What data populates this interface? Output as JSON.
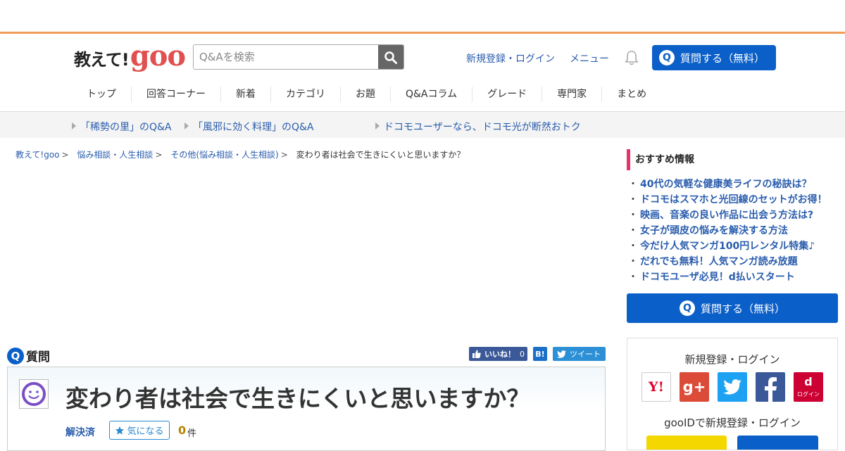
{
  "header": {
    "logo_ja": "教えて!",
    "logo_goo": "goo",
    "search_placeholder": "Q&Aを検索",
    "login_link": "新規登録・ログイン",
    "menu_link": "メニュー",
    "ask_button": "質問する（無料）"
  },
  "nav": {
    "items": [
      "トップ",
      "回答コーナー",
      "新着",
      "カテゴリ",
      "お題",
      "Q&Aコラム",
      "グレード",
      "専門家",
      "まとめ"
    ]
  },
  "subbar": {
    "links": [
      "「稀勢の里」のQ&A",
      "「風邪に効く料理」のQ&A",
      "ドコモユーザーなら、ドコモ光が断然おトク"
    ]
  },
  "breadcrumb": {
    "items": [
      "教えて!goo",
      "悩み相談・人生相談",
      "その他(悩み相談・人生相談)"
    ],
    "current": "変わり者は社会で生きにくいと思いますか？",
    "separator": ">"
  },
  "question": {
    "section_label": "質問",
    "title": "変わり者は社会で生きにくいと思いますか？",
    "status": "解決済",
    "bookmark_label": "気になる",
    "count": "0",
    "count_unit": "件"
  },
  "social": {
    "like_label": "いいね！",
    "like_count": "0",
    "hatena_label": "B!",
    "tweet_label": "ツイート"
  },
  "sidebar": {
    "recommend_title": "おすすめ情報",
    "recommend_items": [
      "40代の気軽な健康美ライフの秘訣は？",
      "ドコモはスマホと光回線のセットがお得！",
      "映画、音楽の良い作品に出会う方法は?",
      "女子が頭皮の悩みを解決する方法",
      "今だけ人気マンガ100円レンタル特集♪",
      "だれでも無料！人気マンガ読み放題",
      "ドコモユーザ必見！d払いスタート"
    ],
    "ask_button": "質問する（無料）",
    "login_title": "新規登録・ログイン",
    "sns": {
      "yahoo": "Y!",
      "google": "g+",
      "docomo_d": "d",
      "docomo_login": "ログイン"
    },
    "gooid_title": "gooIDで新規登録・ログイン"
  },
  "colors": {
    "accent_orange": "#f39c5a",
    "brand_blue": "#0b5fc8",
    "link_blue": "#2a5dad",
    "recommend_pink": "#e6336b"
  }
}
